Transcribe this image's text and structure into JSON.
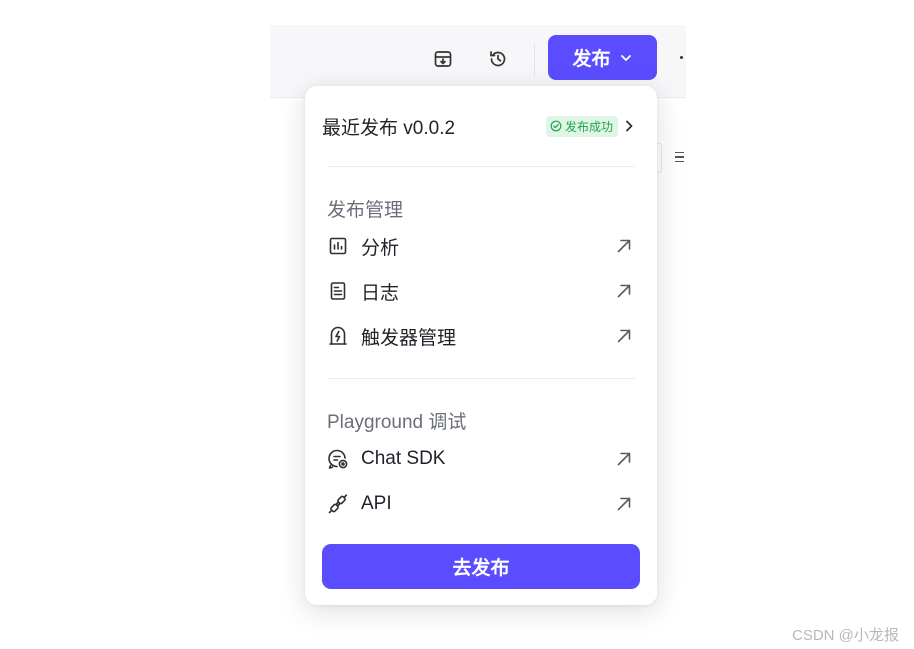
{
  "header": {
    "publish_label": "发布",
    "icons": [
      "download-box-icon",
      "history-icon",
      "chevron-down-icon"
    ]
  },
  "dropdown": {
    "recent_label": "最近发布 v0.0.2",
    "status_badge": "发布成功",
    "section_manage": "发布管理",
    "manage_items": [
      {
        "label": "分析",
        "icon": "analytics-icon"
      },
      {
        "label": "日志",
        "icon": "log-icon"
      },
      {
        "label": "触发器管理",
        "icon": "trigger-icon"
      }
    ],
    "section_playground": "Playground 调试",
    "playground_items": [
      {
        "label": "Chat SDK",
        "icon": "chat-sdk-icon"
      },
      {
        "label": "API",
        "icon": "api-icon"
      }
    ],
    "go_publish_label": "去发布"
  },
  "watermark": "CSDN @小龙报",
  "colors": {
    "accent": "#5a4dff",
    "success_bg": "#dff5e6",
    "success_text": "#23a14d"
  }
}
